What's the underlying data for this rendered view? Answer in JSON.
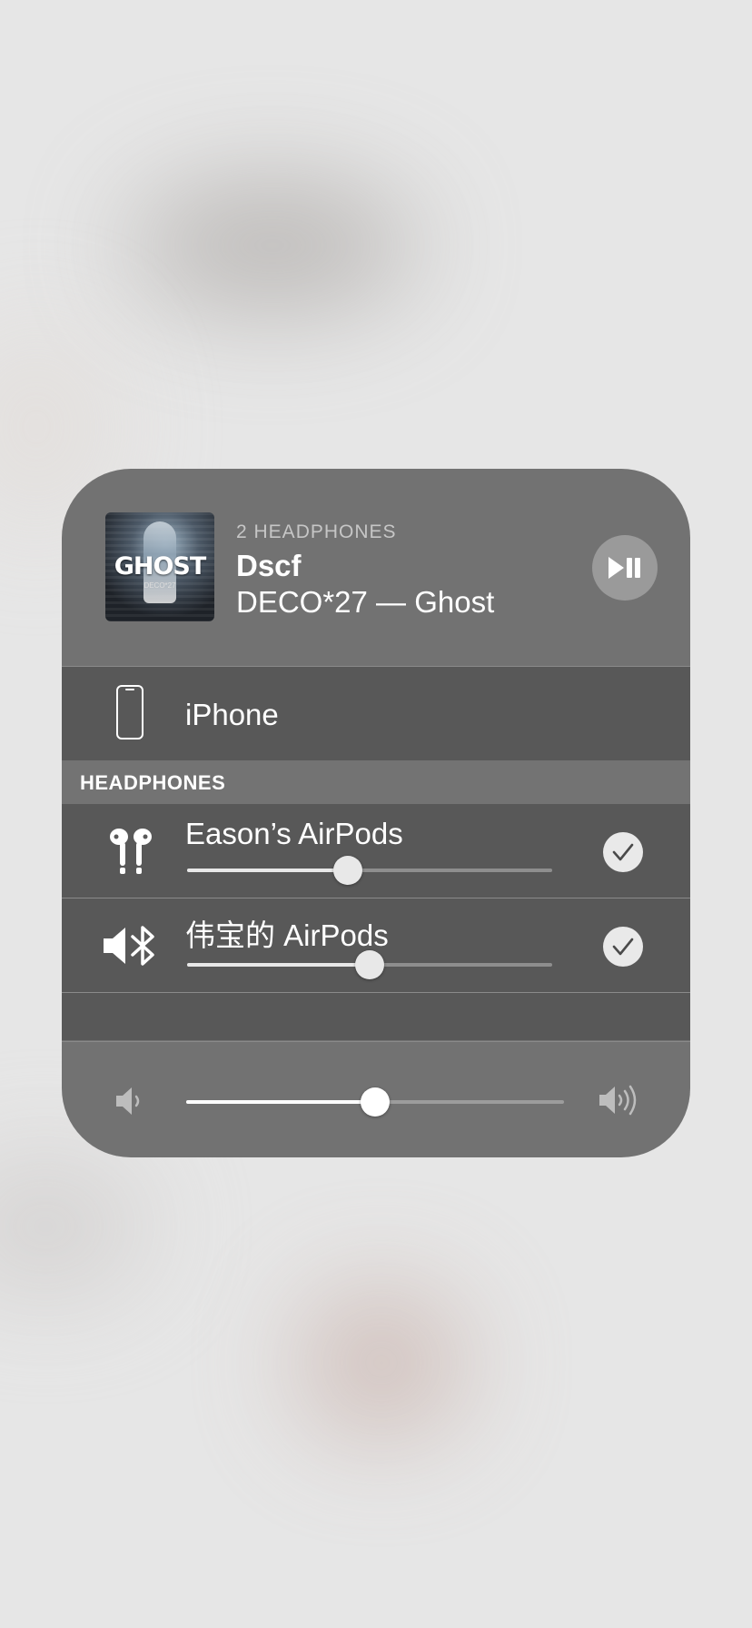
{
  "now_playing": {
    "eyebrow": "2 HEADPHONES",
    "title": "Dscf",
    "subtitle": "DECO*27 — Ghost",
    "artwork_text": "GHOST",
    "artwork_subtext": "DECO*27"
  },
  "routes": {
    "iphone": {
      "label": "iPhone",
      "icon": "iphone-icon"
    },
    "section_header": "HEADPHONES",
    "headphones": [
      {
        "label": "Eason’s AirPods",
        "icon": "airpods-icon",
        "volume": 0.44,
        "selected": true
      },
      {
        "label": "伟宝的 AirPods",
        "icon": "speaker-bluetooth-icon",
        "volume": 0.5,
        "selected": true
      }
    ]
  },
  "master_volume": {
    "value": 0.5,
    "min_icon": "volume-low-icon",
    "max_icon": "volume-high-icon"
  },
  "colors": {
    "panel": "#727272",
    "row_bg": "#585858",
    "section_bg": "#737373",
    "check_bg": "#e9e9e9"
  }
}
